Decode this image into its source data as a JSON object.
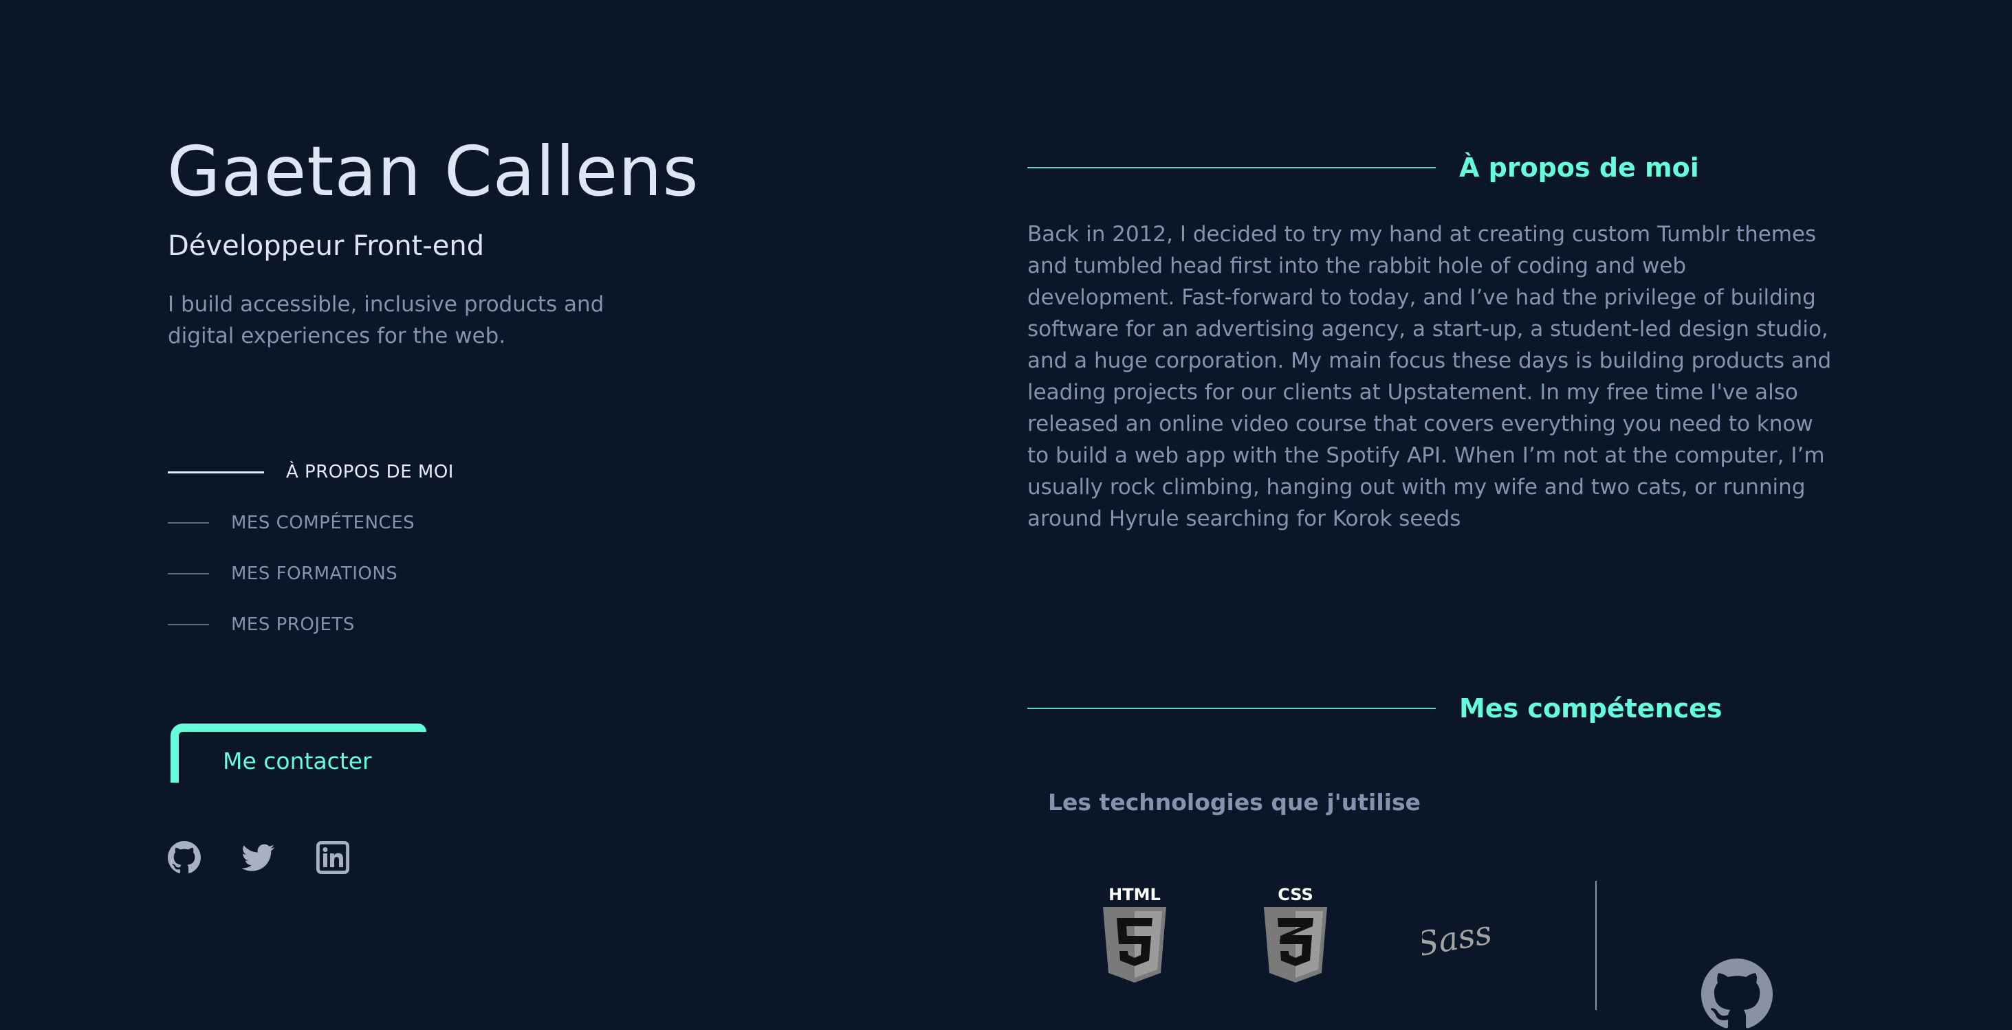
{
  "hero": {
    "name": "Gaetan Callens",
    "role": "Développeur Front-end",
    "tagline": "I build accessible, inclusive products and digital experiences for the web."
  },
  "nav": {
    "items": [
      {
        "label": "À PROPOS DE MOI",
        "active": true
      },
      {
        "label": "MES COMPÉTENCES",
        "active": false
      },
      {
        "label": "MES FORMATIONS",
        "active": false
      },
      {
        "label": "MES PROJETS",
        "active": false
      }
    ]
  },
  "contact": {
    "label": "Me contacter"
  },
  "socials": [
    {
      "icon": "github-icon"
    },
    {
      "icon": "twitter-icon"
    },
    {
      "icon": "linkedin-icon"
    }
  ],
  "about": {
    "title": "À propos de moi",
    "text": "Back in 2012, I decided to try my hand at creating custom Tumblr themes and tumbled head first into the rabbit hole of coding and web development. Fast-forward to today, and I’ve had the privilege of building software for an advertising agency, a start-up, a student-led design studio, and a huge corporation. My main focus these days is building products and leading projects for our clients at Upstatement. In my free time I've also released an online video course that covers everything you need to know to build a web app with the Spotify API. When I’m not at the computer, I’m usually rock climbing, hanging out with my wife and two cats, or running around Hyrule searching for Korok seeds"
  },
  "skills": {
    "title": "Mes compétences",
    "subtitle": "Les technologies que j'utilise",
    "technologies": [
      {
        "icon": "html5-icon",
        "label": "HTML"
      },
      {
        "icon": "css3-icon",
        "label": "CSS"
      },
      {
        "icon": "sass-icon",
        "label": "Sass"
      }
    ],
    "tools": [
      {
        "icon": "github-icon"
      }
    ]
  },
  "colors": {
    "background": "#0b1628",
    "accent": "#64ffda",
    "text_primary": "#dfe6f3",
    "text_secondary": "#8892b0"
  }
}
